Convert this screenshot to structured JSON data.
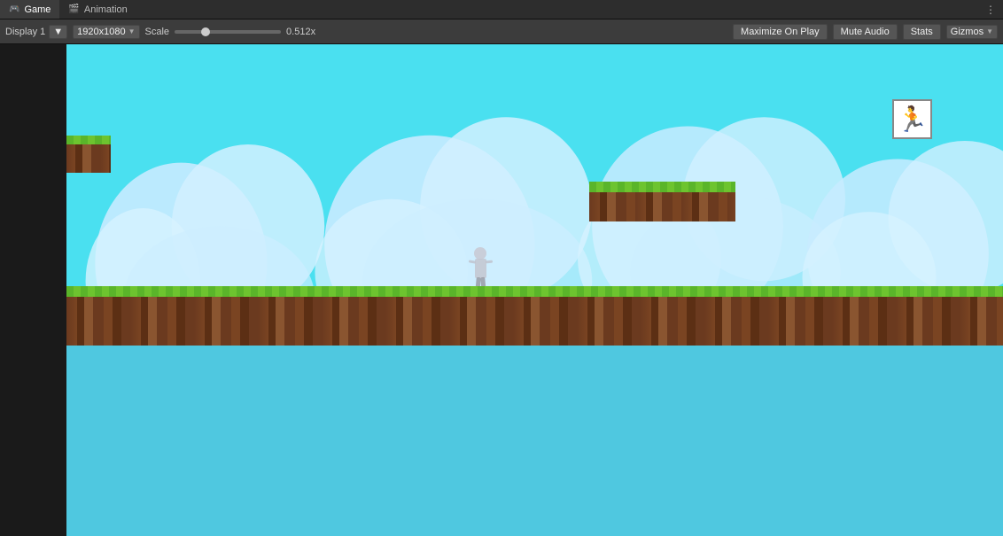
{
  "tabs": [
    {
      "id": "game",
      "label": "Game",
      "icon": "🎮",
      "active": true
    },
    {
      "id": "animation",
      "label": "Animation",
      "icon": "🎬",
      "active": false
    }
  ],
  "toolbar": {
    "display_label": "Display 1",
    "resolution": "1920x1080",
    "scale_label": "Scale",
    "scale_value": "0.512x",
    "maximize_label": "Maximize On Play",
    "mute_label": "Mute Audio",
    "stats_label": "Stats",
    "gizmos_label": "Gizmos"
  },
  "more_icon": "⋮",
  "dropdown_arrow": "▼",
  "char_thumbnail_icon": "🏃"
}
